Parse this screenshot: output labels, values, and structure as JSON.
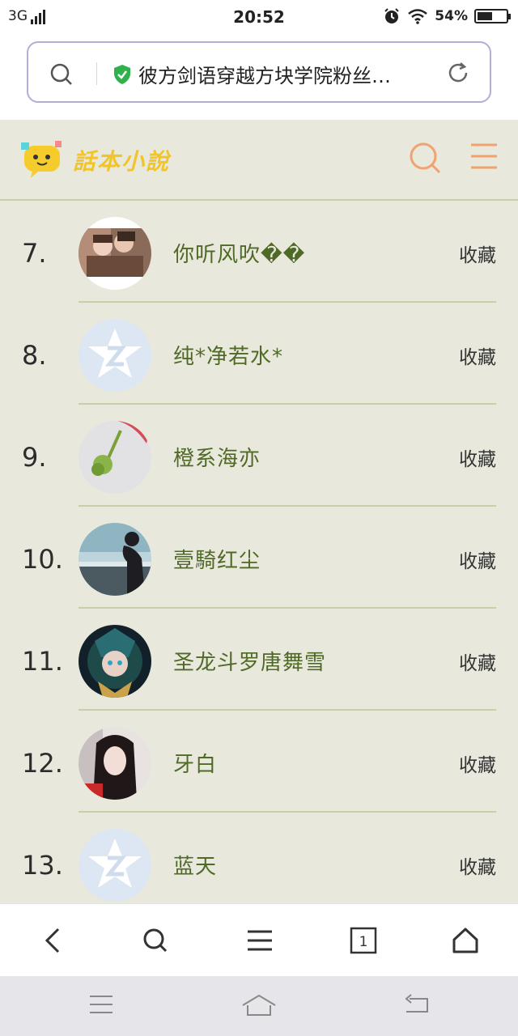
{
  "status_bar": {
    "network": "3G",
    "time": "20:52",
    "battery_percent": "54%",
    "battery_level": 0.54
  },
  "url_bar": {
    "title": "彼方剑语穿越方块学院粉丝…"
  },
  "site": {
    "logo_text": "話本小說"
  },
  "list": [
    {
      "rank": "7.",
      "name": "你听风吹��",
      "action": "收藏",
      "avatar": "photo-couple"
    },
    {
      "rank": "8.",
      "name": "纯*净若水*",
      "action": "收藏",
      "avatar": "default-qq-star"
    },
    {
      "rank": "9.",
      "name": "橙系海亦",
      "action": "收藏",
      "avatar": "photo-flower"
    },
    {
      "rank": "10.",
      "name": "壹騎红尘",
      "action": "收藏",
      "avatar": "photo-silhouette"
    },
    {
      "rank": "11.",
      "name": "圣龙斗罗唐舞雪",
      "action": "收藏",
      "avatar": "photo-anime"
    },
    {
      "rank": "12.",
      "name": "牙白",
      "action": "收藏",
      "avatar": "photo-girl"
    },
    {
      "rank": "13.",
      "name": "蓝天",
      "action": "收藏",
      "avatar": "default-qq-star"
    }
  ],
  "colors": {
    "page_bg": "#e9e8dc",
    "name_text": "#4f6a26",
    "accent": "#f0a36e",
    "logo": "#f1c528",
    "url_border": "#b7acd8"
  }
}
